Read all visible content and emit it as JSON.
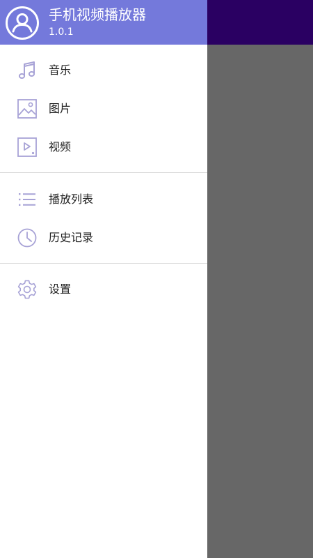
{
  "app": {
    "title": "手机视频播放器",
    "version": "1.0.1"
  },
  "colors": {
    "header_bg": "#7479db",
    "status_bar": "#2a0062",
    "scrim": "#676767",
    "icon_tint": "#a7a2d6"
  },
  "menu": {
    "group1": [
      {
        "label": "音乐",
        "icon": "music-note-icon"
      },
      {
        "label": "图片",
        "icon": "image-icon"
      },
      {
        "label": "视频",
        "icon": "video-icon"
      }
    ],
    "group2": [
      {
        "label": "播放列表",
        "icon": "playlist-icon"
      },
      {
        "label": "历史记录",
        "icon": "history-icon"
      }
    ],
    "group3": [
      {
        "label": "设置",
        "icon": "gear-icon"
      }
    ]
  }
}
